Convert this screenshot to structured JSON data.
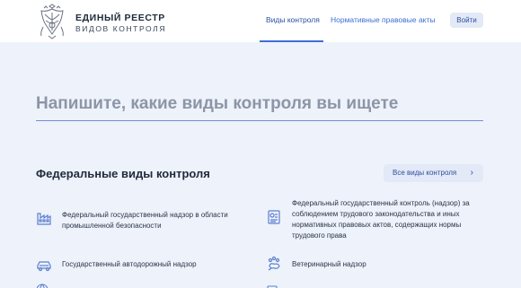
{
  "header": {
    "brand_title": "ЕДИНЫЙ РЕЕСТР",
    "brand_sub": "ВИДОВ КОНТРОЛЯ",
    "nav": [
      "Виды контроля",
      "Нормативные правовые акты"
    ],
    "login_label": "Войти"
  },
  "search": {
    "title": "Напишите, какие виды контроля вы ищете"
  },
  "federal": {
    "title": "Федеральные виды контроля",
    "all_label": "Все виды контроля",
    "items": [
      {
        "label": "Федеральный государственный надзор в области промышленной безопасности",
        "icon": "factory-icon"
      },
      {
        "label": "Федеральный государственный контроль (надзор) за соблюдением трудового законодательства и иных нормативных правовых актов, содержащих нормы трудового права",
        "icon": "document-icon"
      },
      {
        "label": "Государственный автодорожный надзор",
        "icon": "car-icon"
      },
      {
        "label": "Ветеринарный надзор",
        "icon": "paw-icon"
      }
    ]
  },
  "colors": {
    "accent": "#3d6fd6",
    "background": "#eef2fa",
    "button_bg": "#e3e9f6"
  }
}
